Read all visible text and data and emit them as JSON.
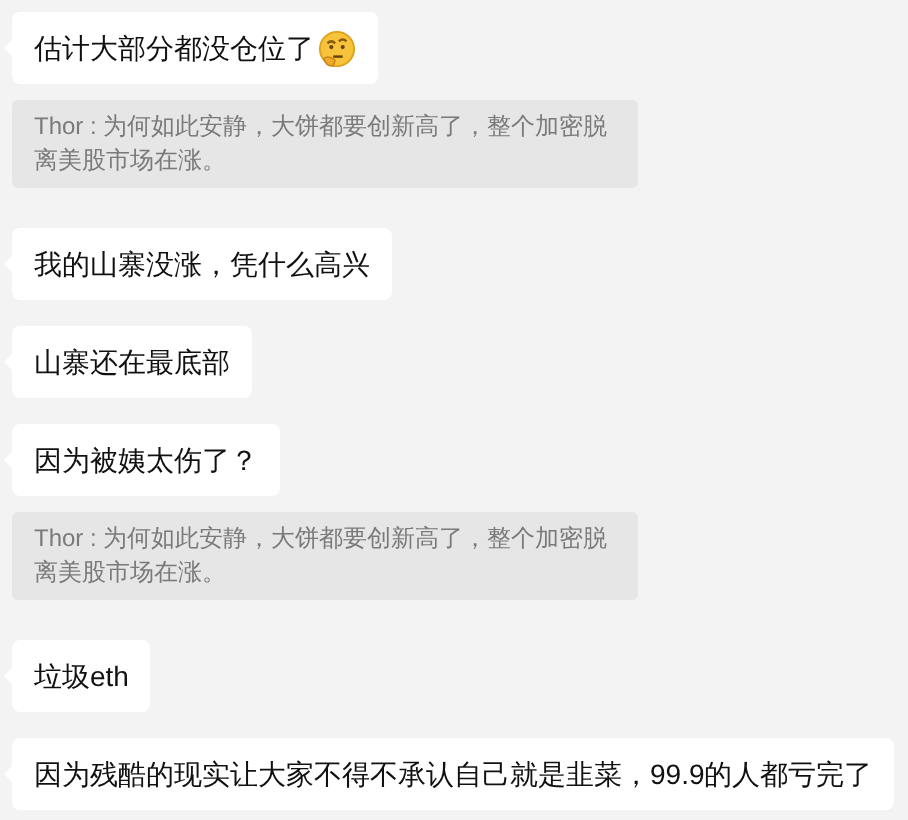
{
  "messages": [
    {
      "kind": "message",
      "text": "估计大部分都没仓位了",
      "emoji": true
    },
    {
      "kind": "quote",
      "text": "Thor : 为何如此安静，大饼都要创新高了，整个加密脱离美股市场在涨。"
    },
    {
      "kind": "message",
      "text": "我的山寨没涨，凭什么高兴"
    },
    {
      "kind": "message",
      "text": "山寨还在最底部"
    },
    {
      "kind": "message",
      "text": "因为被姨太伤了？"
    },
    {
      "kind": "quote",
      "text": "Thor : 为何如此安静，大饼都要创新高了，整个加密脱离美股市场在涨。"
    },
    {
      "kind": "message",
      "text": "垃圾eth"
    },
    {
      "kind": "message",
      "text": "因为残酷的现实让大家不得不承认自己就是韭菜，99.9的人都亏完了"
    }
  ]
}
